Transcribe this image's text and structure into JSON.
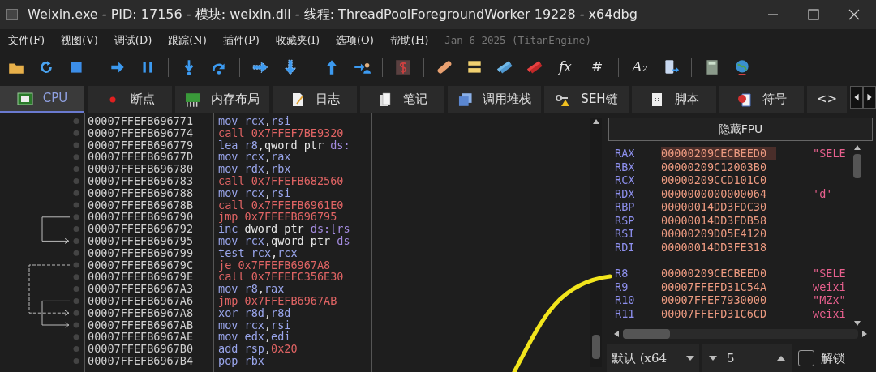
{
  "window": {
    "title": "Weixin.exe - PID: 17156 - 模块: weixin.dll - 线程: ThreadPoolForegroundWorker 19228 - x64dbg"
  },
  "menu": [
    "文件(F)",
    "视图(V)",
    "调试(D)",
    "跟踪(N)",
    "插件(P)",
    "收藏夹(I)",
    "选项(O)",
    "帮助(H)"
  ],
  "build_info": "Jan 6 2025 (TitanEngine)",
  "toolbar": [
    {
      "kind": "icon"
    },
    {
      "kind": "icon"
    },
    {
      "kind": "icon"
    },
    {
      "kind": "separator"
    },
    {
      "kind": "icon"
    },
    {
      "kind": "icon"
    },
    {
      "kind": "separator"
    },
    {
      "kind": "icon"
    },
    {
      "kind": "icon"
    },
    {
      "kind": "separator"
    },
    {
      "kind": "icon"
    },
    {
      "kind": "icon"
    },
    {
      "kind": "separator"
    },
    {
      "kind": "icon"
    },
    {
      "kind": "icon"
    },
    {
      "kind": "separator"
    },
    {
      "kind": "icon"
    },
    {
      "kind": "separator"
    },
    {
      "kind": "icon"
    },
    {
      "kind": "icon"
    },
    {
      "kind": "icon"
    },
    {
      "kind": "icon"
    },
    {
      "kind": "glyph",
      "label": "fx"
    },
    {
      "kind": "glyph",
      "label": "#"
    },
    {
      "kind": "separator"
    },
    {
      "kind": "glyph",
      "label": "A₂"
    },
    {
      "kind": "icon"
    },
    {
      "kind": "separator"
    },
    {
      "kind": "icon"
    },
    {
      "kind": "icon"
    }
  ],
  "tabs": [
    {
      "label": "CPU",
      "selected": true
    },
    {
      "label": "断点",
      "selected": false
    },
    {
      "label": "内存布局",
      "selected": false
    },
    {
      "label": "日志",
      "selected": false
    },
    {
      "label": "笔记",
      "selected": false
    },
    {
      "label": "调用堆栈",
      "selected": false
    },
    {
      "label": "SEH链",
      "selected": false
    },
    {
      "label": "脚本",
      "selected": false
    },
    {
      "label": "符号",
      "selected": false
    },
    {
      "label": "<>",
      "selected": false
    }
  ],
  "disassembly": [
    {
      "address": "00007FFEFB696771",
      "kind": "normal",
      "mnemonic": "mov",
      "operands": [
        {
          "text": "rcx",
          "kind": "reg"
        },
        {
          "text": ",",
          "kind": "plain"
        },
        {
          "text": "rsi",
          "kind": "reg"
        }
      ]
    },
    {
      "address": "00007FFEFB696774",
      "kind": "branch",
      "mnemonic": "call",
      "operands": [
        {
          "text": "0x7FFEF7BE9320",
          "kind": "num"
        }
      ]
    },
    {
      "address": "00007FFEFB696779",
      "kind": "normal",
      "mnemonic": "lea",
      "operands": [
        {
          "text": "r8",
          "kind": "reg"
        },
        {
          "text": ",qword ptr ",
          "kind": "plain"
        },
        {
          "text": "ds:",
          "kind": "seg"
        }
      ]
    },
    {
      "address": "00007FFEFB69677D",
      "kind": "normal",
      "mnemonic": "mov",
      "operands": [
        {
          "text": "rcx",
          "kind": "reg"
        },
        {
          "text": ",",
          "kind": "plain"
        },
        {
          "text": "rax",
          "kind": "reg"
        }
      ]
    },
    {
      "address": "00007FFEFB696780",
      "kind": "normal",
      "mnemonic": "mov",
      "operands": [
        {
          "text": "rdx",
          "kind": "reg"
        },
        {
          "text": ",",
          "kind": "plain"
        },
        {
          "text": "rbx",
          "kind": "reg"
        }
      ]
    },
    {
      "address": "00007FFEFB696783",
      "kind": "branch",
      "mnemonic": "call",
      "operands": [
        {
          "text": "0x7FFEFB682560",
          "kind": "num"
        }
      ]
    },
    {
      "address": "00007FFEFB696788",
      "kind": "normal",
      "mnemonic": "mov",
      "operands": [
        {
          "text": "rcx",
          "kind": "reg"
        },
        {
          "text": ",",
          "kind": "plain"
        },
        {
          "text": "rsi",
          "kind": "reg"
        }
      ]
    },
    {
      "address": "00007FFEFB69678B",
      "kind": "branch",
      "mnemonic": "call",
      "operands": [
        {
          "text": "0x7FFEFB6961E0",
          "kind": "num"
        }
      ]
    },
    {
      "address": "00007FFEFB696790",
      "kind": "branch",
      "mnemonic": "jmp",
      "operands": [
        {
          "text": "0x7FFEFB696795",
          "kind": "num"
        }
      ]
    },
    {
      "address": "00007FFEFB696792",
      "kind": "normal",
      "mnemonic": "inc",
      "operands": [
        {
          "text": "dword ptr ",
          "kind": "plain"
        },
        {
          "text": "ds:[rs",
          "kind": "seg"
        }
      ]
    },
    {
      "address": "00007FFEFB696795",
      "kind": "normal",
      "mnemonic": "mov",
      "operands": [
        {
          "text": "rcx",
          "kind": "reg"
        },
        {
          "text": ",qword ptr ",
          "kind": "plain"
        },
        {
          "text": "ds",
          "kind": "seg"
        }
      ]
    },
    {
      "address": "00007FFEFB696799",
      "kind": "normal",
      "mnemonic": "test",
      "operands": [
        {
          "text": "rcx",
          "kind": "reg"
        },
        {
          "text": ",",
          "kind": "plain"
        },
        {
          "text": "rcx",
          "kind": "reg"
        }
      ]
    },
    {
      "address": "00007FFEFB69679C",
      "kind": "branch",
      "mnemonic": "je",
      "operands": [
        {
          "text": "0x7FFEFB6967A8",
          "kind": "num"
        }
      ]
    },
    {
      "address": "00007FFEFB69679E",
      "kind": "branch",
      "mnemonic": "call",
      "operands": [
        {
          "text": "0x7FFEFC356E30",
          "kind": "num"
        }
      ]
    },
    {
      "address": "00007FFEFB6967A3",
      "kind": "normal",
      "mnemonic": "mov",
      "operands": [
        {
          "text": "r8",
          "kind": "reg"
        },
        {
          "text": ",",
          "kind": "plain"
        },
        {
          "text": "rax",
          "kind": "reg"
        }
      ]
    },
    {
      "address": "00007FFEFB6967A6",
      "kind": "branch",
      "mnemonic": "jmp",
      "operands": [
        {
          "text": "0x7FFEFB6967AB",
          "kind": "num"
        }
      ]
    },
    {
      "address": "00007FFEFB6967A8",
      "kind": "normal",
      "mnemonic": "xor",
      "operands": [
        {
          "text": "r8d",
          "kind": "reg"
        },
        {
          "text": ",",
          "kind": "plain"
        },
        {
          "text": "r8d",
          "kind": "reg"
        }
      ]
    },
    {
      "address": "00007FFEFB6967AB",
      "kind": "normal",
      "mnemonic": "mov",
      "operands": [
        {
          "text": "rcx",
          "kind": "reg"
        },
        {
          "text": ",",
          "kind": "plain"
        },
        {
          "text": "rsi",
          "kind": "reg"
        }
      ]
    },
    {
      "address": "00007FFEFB6967AE",
      "kind": "normal",
      "mnemonic": "mov",
      "operands": [
        {
          "text": "edx",
          "kind": "reg"
        },
        {
          "text": ",",
          "kind": "plain"
        },
        {
          "text": "edi",
          "kind": "reg"
        }
      ]
    },
    {
      "address": "00007FFEFB6967B0",
      "kind": "normal",
      "mnemonic": "add",
      "operands": [
        {
          "text": "rsp",
          "kind": "reg"
        },
        {
          "text": ",",
          "kind": "plain"
        },
        {
          "text": "0x20",
          "kind": "num"
        }
      ]
    },
    {
      "address": "00007FFEFB6967B4",
      "kind": "normal",
      "mnemonic": "pop",
      "operands": [
        {
          "text": "rbx",
          "kind": "reg"
        }
      ]
    }
  ],
  "registers_panel": {
    "toggle_button": "隐藏FPU",
    "groups": [
      [
        {
          "name": "RAX",
          "value": "00000209CECBEED0",
          "comment": "\"SELE",
          "highlighted": true
        },
        {
          "name": "RBX",
          "value": "00000209C12003B0",
          "highlighted": false
        },
        {
          "name": "RCX",
          "value": "00000209CCD101C0",
          "highlighted": false
        },
        {
          "name": "RDX",
          "value": "0000000000000064",
          "comment": "'d'",
          "highlighted": false
        },
        {
          "name": "RBP",
          "value": "00000014DD3FDC30",
          "highlighted": false
        },
        {
          "name": "RSP",
          "value": "00000014DD3FDB58",
          "highlighted": false
        },
        {
          "name": "RSI",
          "value": "00000209D05E4120",
          "highlighted": false
        },
        {
          "name": "RDI",
          "value": "00000014DD3FE318",
          "highlighted": false
        }
      ],
      [
        {
          "name": "R8",
          "value": "00000209CECBEED0",
          "comment": "\"SELE",
          "highlighted": false
        },
        {
          "name": "R9",
          "value": "00007FFEFD31C54A",
          "comment": "weixi",
          "highlighted": false
        },
        {
          "name": "R10",
          "value": "00007FFEF7930000",
          "comment": "\"MZx\"",
          "highlighted": false
        },
        {
          "name": "R11",
          "value": "00007FFEFD31C6CD",
          "comment": "weixi",
          "highlighted": false
        }
      ]
    ],
    "calling_convention": "默认 (x64",
    "arg_count": "5",
    "unlock": {
      "label": "解锁",
      "checked": false
    }
  }
}
